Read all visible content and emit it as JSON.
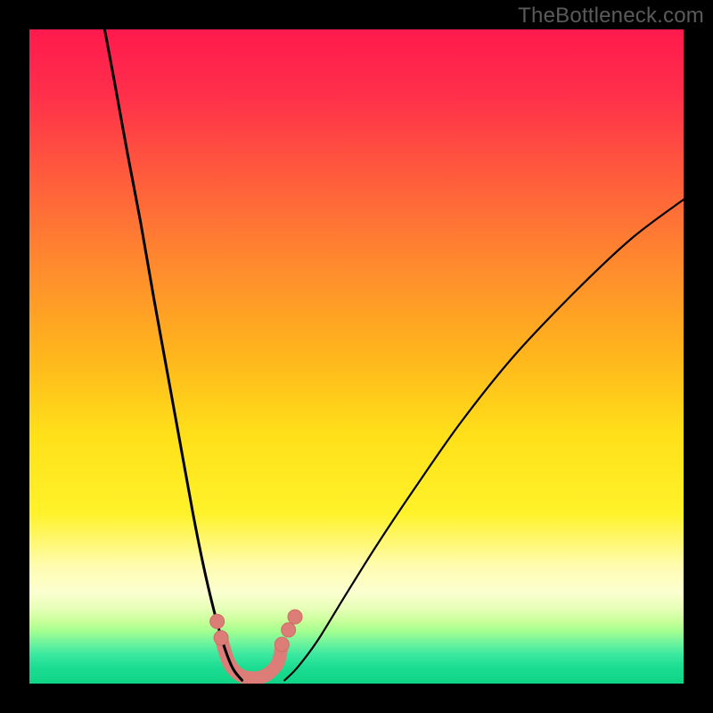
{
  "watermark": "TheBottleneck.com",
  "chart_data": {
    "type": "line",
    "title": "",
    "xlabel": "",
    "ylabel": "",
    "xlim": [
      0,
      100
    ],
    "ylim": [
      0,
      100
    ],
    "grid": false,
    "series": [
      {
        "name": "left-curve",
        "x": [
          11.5,
          13,
          15,
          17,
          19,
          21,
          23,
          25,
          26.5,
          28,
          29.5,
          31,
          32.5
        ],
        "y": [
          100,
          92,
          81,
          70.5,
          59,
          48,
          37,
          26,
          18.5,
          12,
          6.5,
          2.5,
          0.5
        ]
      },
      {
        "name": "right-curve",
        "x": [
          39,
          41,
          44,
          48,
          53,
          59,
          66,
          74,
          83,
          92,
          100
        ],
        "y": [
          0.5,
          2.5,
          6.5,
          13,
          21,
          30,
          40,
          50,
          59.5,
          68,
          74
        ]
      },
      {
        "name": "marker-dots",
        "x": [
          28.7,
          29.3,
          38.6,
          39.6,
          40.6
        ],
        "y": [
          9.5,
          7.0,
          6.0,
          8.2,
          10.2
        ]
      },
      {
        "name": "valley-line",
        "x": [
          29.3,
          30.5,
          32,
          33.5,
          35,
          36.5,
          38,
          38.6
        ],
        "y": [
          7.0,
          3.2,
          1.4,
          0.9,
          0.9,
          1.5,
          3.2,
          6.0
        ]
      }
    ]
  },
  "background": {
    "gradient_stops": [
      {
        "offset": 0.0,
        "color": "#ff1a4d"
      },
      {
        "offset": 0.1,
        "color": "#ff2f4a"
      },
      {
        "offset": 0.22,
        "color": "#ff5a3d"
      },
      {
        "offset": 0.36,
        "color": "#ff8a2e"
      },
      {
        "offset": 0.5,
        "color": "#ffb61c"
      },
      {
        "offset": 0.62,
        "color": "#ffe019"
      },
      {
        "offset": 0.74,
        "color": "#fff22a"
      },
      {
        "offset": 0.82,
        "color": "#fffcb0"
      },
      {
        "offset": 0.86,
        "color": "#fcffd0"
      },
      {
        "offset": 0.885,
        "color": "#e7ffb8"
      },
      {
        "offset": 0.905,
        "color": "#c7ff9a"
      },
      {
        "offset": 0.92,
        "color": "#a3ff90"
      },
      {
        "offset": 0.935,
        "color": "#77f59c"
      },
      {
        "offset": 0.955,
        "color": "#3ce9a0"
      },
      {
        "offset": 0.975,
        "color": "#1bdd92"
      },
      {
        "offset": 1.0,
        "color": "#0fd485"
      }
    ]
  },
  "style": {
    "curve_stroke": "#000000",
    "curve_width_left_top": 3.0,
    "curve_width_right_top": 2.2,
    "marker_fill": "#dc7d77",
    "marker_stroke": "#cf6c65",
    "marker_radius": 8,
    "valley_stroke": "#dc7d77",
    "valley_width": 15
  }
}
